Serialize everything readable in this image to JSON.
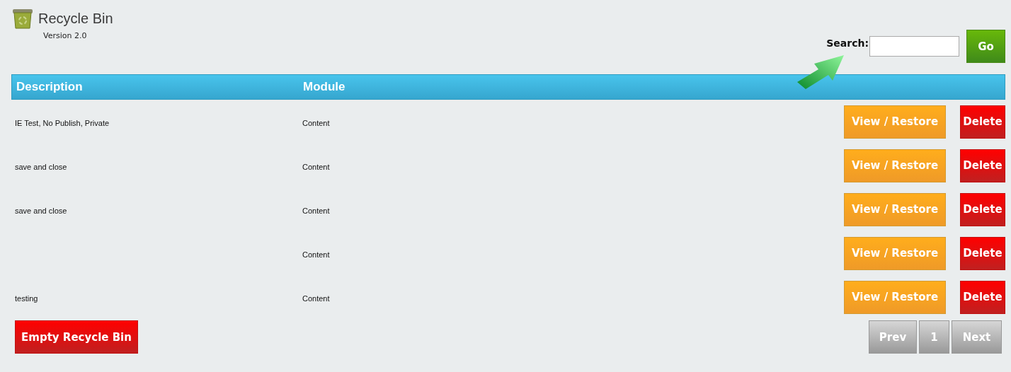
{
  "header": {
    "title": "Recycle Bin",
    "version": "Version 2.0"
  },
  "search": {
    "label": "Search:",
    "button": "Go"
  },
  "table": {
    "columns": [
      "Description",
      "Module"
    ],
    "rows": [
      {
        "description": "IE Test, No Publish, Private",
        "module": "Content",
        "restore": "View / Restore",
        "delete": "Delete"
      },
      {
        "description": "save and close",
        "module": "Content",
        "restore": "View / Restore",
        "delete": "Delete"
      },
      {
        "description": "save and close",
        "module": "Content",
        "restore": "View / Restore",
        "delete": "Delete"
      },
      {
        "description": "",
        "module": "Content",
        "restore": "View / Restore",
        "delete": "Delete"
      },
      {
        "description": "testing",
        "module": "Content",
        "restore": "View / Restore",
        "delete": "Delete"
      }
    ]
  },
  "empty_button": "Empty Recycle Bin",
  "pagination": {
    "prev": "Prev",
    "pages": [
      "1"
    ],
    "next": "Next"
  }
}
